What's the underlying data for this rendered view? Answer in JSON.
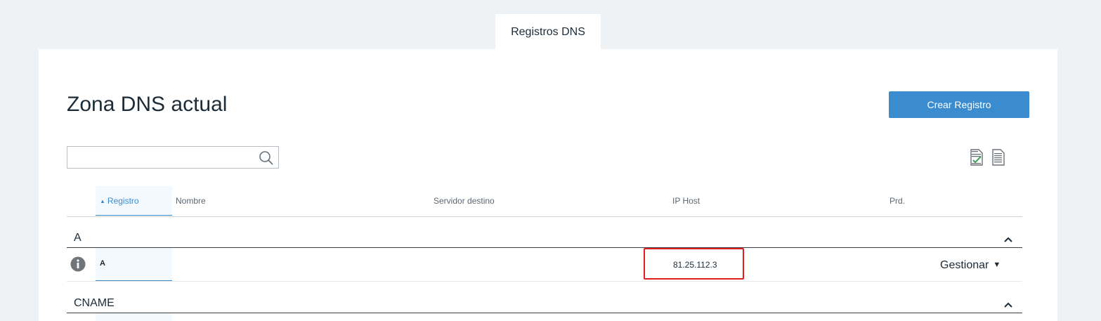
{
  "tab": {
    "label": "Registros DNS"
  },
  "page": {
    "title": "Zona DNS actual"
  },
  "actions": {
    "create_label": "Crear Registro"
  },
  "search": {
    "value": "",
    "placeholder": ""
  },
  "icons": {
    "search": "search-icon",
    "export_edit": "document-edit-icon",
    "export_doc": "document-icon",
    "info": "info-icon",
    "collapse": "chevron-up-icon",
    "dropdown": "caret-down-icon"
  },
  "table": {
    "columns": [
      "Registro",
      "Nombre",
      "Servidor destino",
      "IP Host",
      "Prd."
    ],
    "groups": [
      {
        "label": "A",
        "rows": [
          {
            "registro": "A",
            "nombre": "",
            "servidor_destino": "",
            "ip_host": "81.25.112.3",
            "prd": "",
            "action": "Gestionar"
          }
        ]
      },
      {
        "label": "CNAME",
        "rows": []
      }
    ]
  },
  "colors": {
    "accent": "#3a8ccf",
    "highlight": "#e01f1f",
    "background": "#eff2f5"
  }
}
